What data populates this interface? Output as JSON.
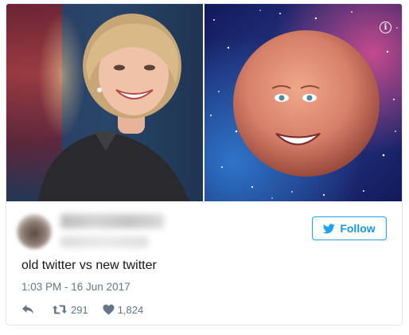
{
  "tweet": {
    "text": "old twitter vs new twitter",
    "timestamp": "1:03 PM - 16 Jun 2017",
    "retweet_count": "291",
    "like_count": "1,824"
  },
  "follow_button": {
    "label": "Follow"
  },
  "colors": {
    "twitter_blue": "#1da1f2",
    "text_primary": "#14171a",
    "text_secondary": "#657786"
  },
  "icons": {
    "reply": "reply-icon",
    "retweet": "retweet-icon",
    "like": "heart-icon",
    "info": "info-icon",
    "follow": "twitter-bird-icon"
  }
}
